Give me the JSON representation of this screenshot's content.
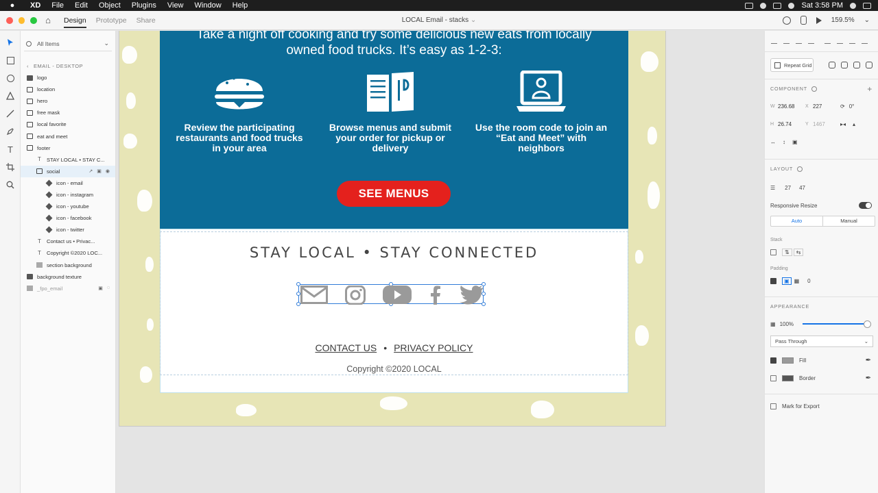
{
  "menubar": {
    "apple": "",
    "app": "XD",
    "items": [
      "File",
      "Edit",
      "Object",
      "Plugins",
      "View",
      "Window",
      "Help"
    ],
    "time": "Sat 3:58 PM"
  },
  "header": {
    "modes": [
      "Design",
      "Prototype",
      "Share"
    ],
    "active_mode": "Design",
    "doc_title": "LOCAL Email - stacks",
    "zoom": "159.5%"
  },
  "layers": {
    "filter": "All Items",
    "artboard_label": "EMAIL - DESKTOP",
    "items": [
      {
        "label": "logo",
        "icon": "group",
        "indent": 0
      },
      {
        "label": "location",
        "icon": "folder",
        "indent": 0
      },
      {
        "label": "hero",
        "icon": "folder",
        "indent": 0
      },
      {
        "label": "free mask",
        "icon": "folder",
        "indent": 0
      },
      {
        "label": "local favorite",
        "icon": "folder",
        "indent": 0
      },
      {
        "label": "eat and meet",
        "icon": "folder",
        "indent": 0
      },
      {
        "label": "footer",
        "icon": "folder",
        "indent": 0
      },
      {
        "label": "STAY LOCAL • STAY C...",
        "icon": "text",
        "indent": 1
      },
      {
        "label": "social",
        "icon": "folder",
        "indent": 1
      },
      {
        "label": "icon - email",
        "icon": "diamond",
        "indent": 2
      },
      {
        "label": "icon - instagram",
        "icon": "diamond",
        "indent": 2
      },
      {
        "label": "icon - youtube",
        "icon": "diamond",
        "indent": 2
      },
      {
        "label": "icon - facebook",
        "icon": "diamond",
        "indent": 2
      },
      {
        "label": "icon - twitter",
        "icon": "diamond",
        "indent": 2
      },
      {
        "label": "Contact us  •  Privac...",
        "icon": "text",
        "indent": 1
      },
      {
        "label": "Copyright ©2020 LOC...",
        "icon": "text",
        "indent": 1
      },
      {
        "label": "section background",
        "icon": "rect",
        "indent": 1
      },
      {
        "label": "background texture",
        "icon": "group",
        "indent": 0
      },
      {
        "label": "_fpo_email",
        "icon": "rect",
        "indent": 0
      }
    ]
  },
  "email": {
    "hero_text_line1": "Take a night off cooking and try some delicious new eats from locally",
    "hero_text_line2": "owned food trucks. It’s easy as 1-2-3:",
    "steps": [
      {
        "caption": "Review the participating restaurants and food trucks in your area",
        "icon": "burger-icon"
      },
      {
        "caption": "Browse menus and submit your order for pickup or delivery",
        "icon": "menu-icon"
      },
      {
        "caption": "Use the room code to join an “Eat and Meet” with neighbors",
        "icon": "laptop-user-icon"
      }
    ],
    "cta": "SEE MENUS",
    "footer_heading": "STAY LOCAL • STAY CONNECTED",
    "social_icons": [
      "email-icon",
      "instagram-icon",
      "youtube-icon",
      "facebook-icon",
      "twitter-icon"
    ],
    "contact_link": "CONTACT US",
    "separator": "•",
    "privacy_link": "PRIVACY POLICY",
    "copyright": "Copyright ©2020 LOCAL"
  },
  "inspector": {
    "repeat_grid": "Repeat Grid",
    "component_label": "COMPONENT",
    "w_label": "W",
    "w": "236.68",
    "x_label": "X",
    "x": "227",
    "rotation": "0°",
    "h_label": "H",
    "h": "26.74",
    "y_label": "Y",
    "y": "1467",
    "layout_label": "LAYOUT",
    "layout_a": "27",
    "layout_b": "47",
    "responsive_resize": "Responsive Resize",
    "auto": "Auto",
    "manual": "Manual",
    "stack": "Stack",
    "padding": "Padding",
    "padding_val": "0",
    "appearance": "APPEARANCE",
    "opacity": "100%",
    "blend": "Pass Through",
    "fill": "Fill",
    "border": "Border",
    "mark_export": "Mark for Export"
  },
  "colors": {
    "email_blue": "#0c6c98",
    "cta_red": "#e4211d",
    "artboard_bg": "#e7e5b6",
    "selection": "#2f7bd8",
    "social_gray": "#9a9a9a"
  }
}
